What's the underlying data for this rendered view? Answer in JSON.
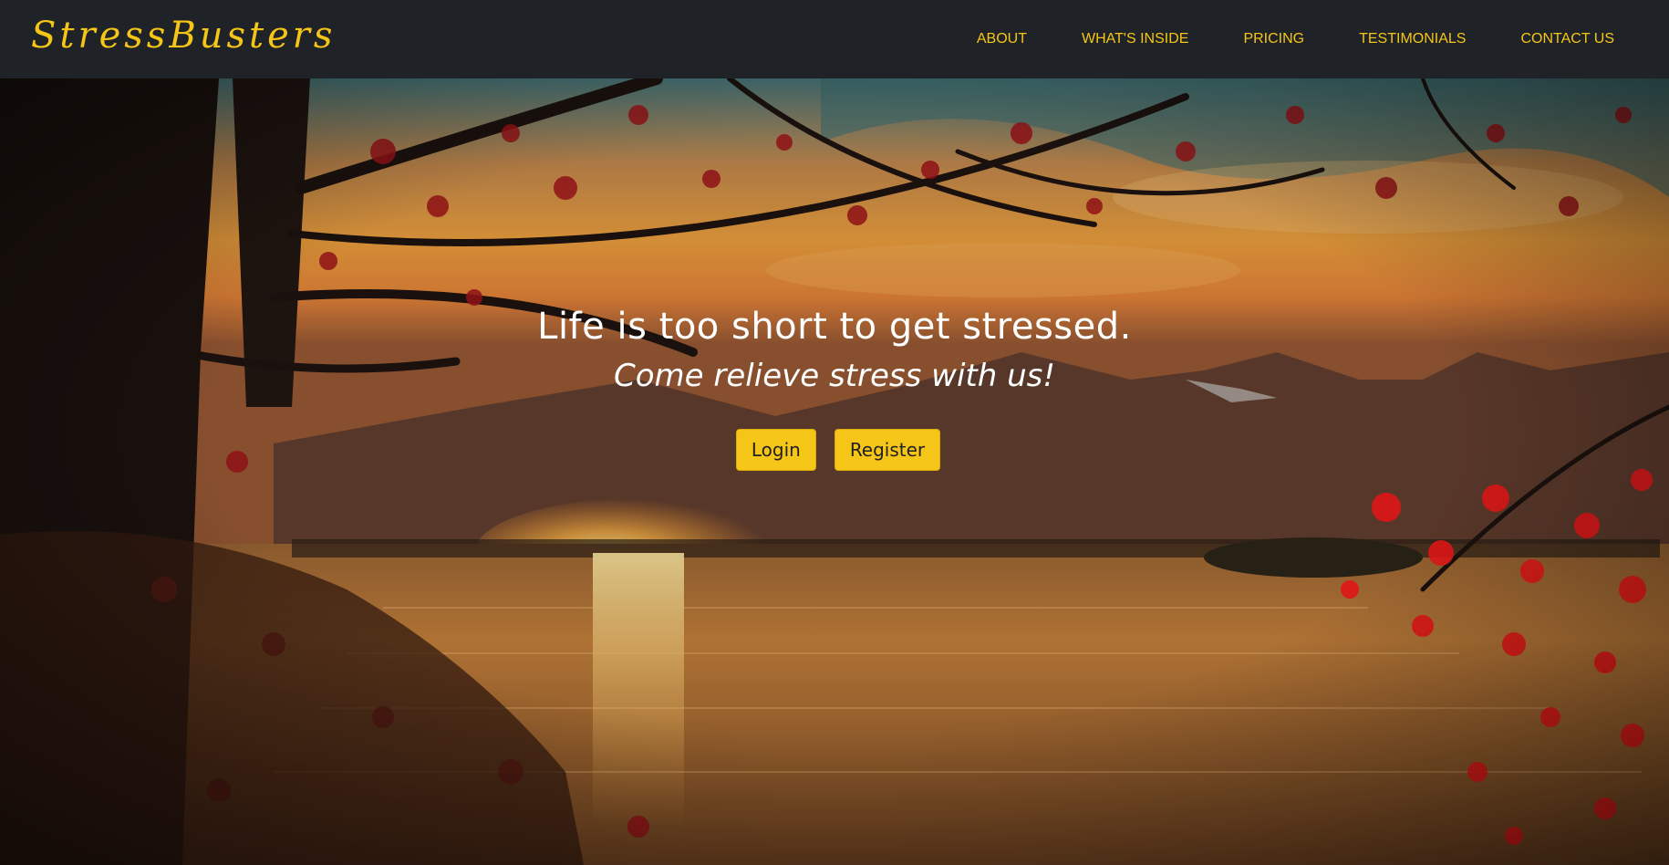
{
  "navbar": {
    "brand": "StressBusters",
    "links": [
      {
        "label": "ABOUT"
      },
      {
        "label": "WHAT'S INSIDE"
      },
      {
        "label": "PRICING"
      },
      {
        "label": "TESTIMONIALS"
      },
      {
        "label": "CONTACT US"
      }
    ]
  },
  "hero": {
    "title": "Life is too short to get stressed.",
    "subtitle": "Come relieve stress with us!",
    "buttons": {
      "login_label": "Login",
      "register_label": "Register"
    }
  },
  "colors": {
    "navbar_bg": "#1f2328",
    "accent": "#f5c518",
    "hero_text": "#ffffff"
  },
  "icons": {
    "background": "autumn-lake-sunset-photo"
  }
}
